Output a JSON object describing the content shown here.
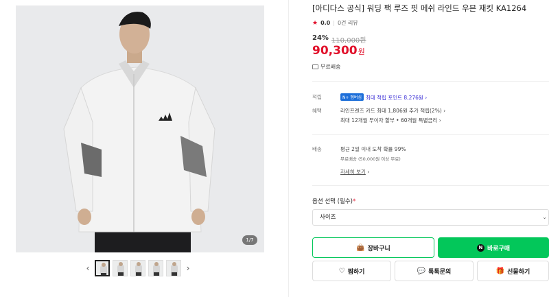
{
  "gallery": {
    "counter": "1/7",
    "prev_arrow": "‹",
    "next_arrow": "›",
    "thumbnail_count": 5
  },
  "product": {
    "title": "[아디다스 공식] 워딩 팩 루즈 핏 메쉬 라인드 우븐 재킷 KA1264",
    "rating": "0.0",
    "reviews": "0건 리뷰",
    "discount": "24%",
    "original_price": "110,000원",
    "price": "90,300",
    "currency": "원",
    "free_shipping": "무료배송"
  },
  "benefits": {
    "points_label": "적립",
    "npay_badge": "N+ 멤버십",
    "points_text": "최대 적립 포인트 8,276원 ›",
    "perks_label": "혜택",
    "perk1": "라인프렌즈 카드 최대 1,806원 추가 적립(2%) ›",
    "perk2": "최대 12개월 무이자 할부 • 60개월 특별금리 ›"
  },
  "shipping": {
    "label": "배송",
    "line1": "평균 2일 이내 도착 확률 99%",
    "line2": "무료배송 (50,000원 이상 무료)",
    "details_link": "자세히 보기",
    "details_chevron": "›"
  },
  "options": {
    "title": "옵션 선택 (필수)",
    "required_mark": "*",
    "select_value": "사이즈",
    "chevron": "⌄"
  },
  "buttons": {
    "cart": "장바구니",
    "buy": "바로구매",
    "buy_n": "N",
    "wish": "찜하기",
    "talk": "톡톡문의",
    "gift": "선물하기"
  },
  "colors": {
    "accent_green": "#03c75a",
    "price_red": "#e1112b",
    "points_purple": "#3b2fd6"
  }
}
